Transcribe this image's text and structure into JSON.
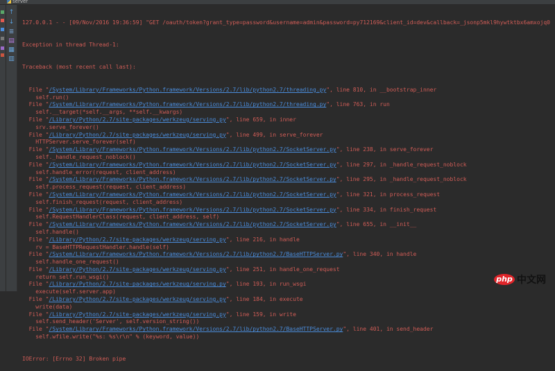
{
  "window": {
    "tab_label": "server"
  },
  "toolbar": {
    "icons": [
      "arrow-up-icon",
      "arrow-down-icon",
      "soft-wrap-icon",
      "scroll-to-end-icon",
      "print-icon",
      "trash-icon"
    ]
  },
  "console": {
    "request_line": "127.0.0.1 - - [09/Nov/2016 19:36:59] \"GET /oauth/token?grant_type=password&username=admin&password=py712169&client_id=dev&callback=_jsonp5mkl9hywtktbx6amxojq0",
    "exception_line": "Exception in thread Thread-1:",
    "traceback_header": "Traceback (most recent call last):",
    "frames": [
      {
        "path": "/System/Library/Frameworks/Python.framework/Versions/2.7/lib/python2.7/threading.py",
        "line": "810",
        "func": "__bootstrap_inner",
        "code": "self.run()"
      },
      {
        "path": "/System/Library/Frameworks/Python.framework/Versions/2.7/lib/python2.7/threading.py",
        "line": "763",
        "func": "run",
        "code": "self.__target(*self.__args, **self.__kwargs)"
      },
      {
        "path": "/Library/Python/2.7/site-packages/werkzeug/serving.py",
        "line": "659",
        "func": "inner",
        "code": "srv.serve_forever()"
      },
      {
        "path": "/Library/Python/2.7/site-packages/werkzeug/serving.py",
        "line": "499",
        "func": "serve_forever",
        "code": "HTTPServer.serve_forever(self)"
      },
      {
        "path": "/System/Library/Frameworks/Python.framework/Versions/2.7/lib/python2.7/SocketServer.py",
        "line": "238",
        "func": "serve_forever",
        "code": "self._handle_request_noblock()"
      },
      {
        "path": "/System/Library/Frameworks/Python.framework/Versions/2.7/lib/python2.7/SocketServer.py",
        "line": "297",
        "func": "_handle_request_noblock",
        "code": "self.handle_error(request, client_address)"
      },
      {
        "path": "/System/Library/Frameworks/Python.framework/Versions/2.7/lib/python2.7/SocketServer.py",
        "line": "295",
        "func": "_handle_request_noblock",
        "code": "self.process_request(request, client_address)"
      },
      {
        "path": "/System/Library/Frameworks/Python.framework/Versions/2.7/lib/python2.7/SocketServer.py",
        "line": "321",
        "func": "process_request",
        "code": "self.finish_request(request, client_address)"
      },
      {
        "path": "/System/Library/Frameworks/Python.framework/Versions/2.7/lib/python2.7/SocketServer.py",
        "line": "334",
        "func": "finish_request",
        "code": "self.RequestHandlerClass(request, client_address, self)"
      },
      {
        "path": "/System/Library/Frameworks/Python.framework/Versions/2.7/lib/python2.7/SocketServer.py",
        "line": "655",
        "func": "__init__",
        "code": "self.handle()"
      },
      {
        "path": "/Library/Python/2.7/site-packages/werkzeug/serving.py",
        "line": "216",
        "func": "handle",
        "code": "rv = BaseHTTPRequestHandler.handle(self)"
      },
      {
        "path": "/System/Library/Frameworks/Python.framework/Versions/2.7/lib/python2.7/BaseHTTPServer.py",
        "line": "340",
        "func": "handle",
        "code": "self.handle_one_request()"
      },
      {
        "path": "/Library/Python/2.7/site-packages/werkzeug/serving.py",
        "line": "251",
        "func": "handle_one_request",
        "code": "return self.run_wsgi()"
      },
      {
        "path": "/Library/Python/2.7/site-packages/werkzeug/serving.py",
        "line": "193",
        "func": "run_wsgi",
        "code": "execute(self.server.app)"
      },
      {
        "path": "/Library/Python/2.7/site-packages/werkzeug/serving.py",
        "line": "184",
        "func": "execute",
        "code": "write(data)"
      },
      {
        "path": "/Library/Python/2.7/site-packages/werkzeug/serving.py",
        "line": "159",
        "func": "write",
        "code": "self.send_header('Server', self.version_string())"
      },
      {
        "path": "/System/Library/Frameworks/Python.framework/Versions/2.7/lib/python2.7/BaseHTTPServer.py",
        "line": "401",
        "func": "send_header",
        "code": "self.wfile.write(\"%s: %s\\r\\n\" % (keyword, value))"
      }
    ],
    "error_line": "IOError: [Errno 32] Broken pipe"
  },
  "watermark": {
    "logo": "php",
    "text": "中文网"
  },
  "colors": {
    "background": "#2b2b2b",
    "error_text": "#d25d57",
    "link": "#4b8ddc"
  }
}
